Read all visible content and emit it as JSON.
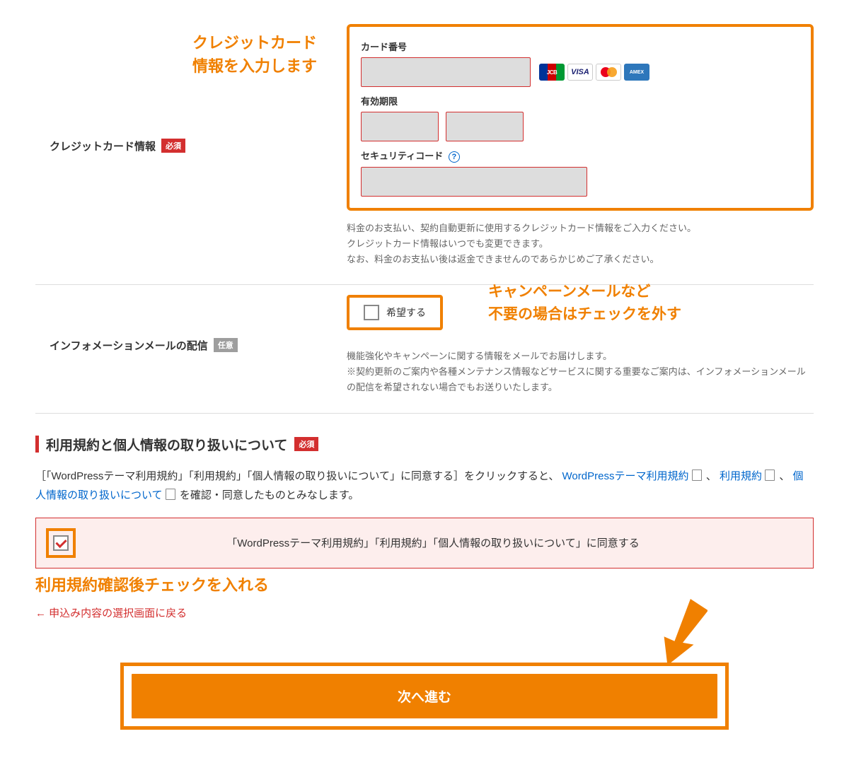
{
  "cc": {
    "label": "クレジットカード情報",
    "required_badge": "必須",
    "annot": "クレジットカード\n情報を入力します",
    "card_number_label": "カード番号",
    "expiry_label": "有効期限",
    "security_label": "セキュリティコード",
    "brands": {
      "jcb": "JCB",
      "visa": "VISA",
      "amex": "AMEX"
    },
    "hint1": "料金のお支払い、契約自動更新に使用するクレジットカード情報をご入力ください。",
    "hint2": "クレジットカード情報はいつでも変更できます。",
    "hint3": "なお、料金のお支払い後は返金できませんのであらかじめご了承ください。"
  },
  "mail": {
    "label": "インフォメーションメールの配信",
    "optional_badge": "任意",
    "checkbox_label": "希望する",
    "annot": "キャンペーンメールなど\n不要の場合はチェックを外す",
    "hint1": "機能強化やキャンペーンに関する情報をメールでお届けします。",
    "hint2": "※契約更新のご案内や各種メンテナンス情報などサービスに関する重要なご案内は、インフォメーションメールの配信を希望されない場合でもお送りいたします。"
  },
  "terms": {
    "heading": "利用規約と個人情報の取り扱いについて",
    "required_badge": "必須",
    "text_pre": "［「WordPressテーマ利用規約」「利用規約」「個人情報の取り扱いについて」に同意する］をクリックすると、",
    "link1": "WordPressテーマ利用規約",
    "sep1": "、",
    "link2": "利用規約",
    "sep2": "、",
    "link3": "個人情報の取り扱いについて",
    "text_post": " を確認・同意したものとみなします。",
    "agree_label": "「WordPressテーマ利用規約」「利用規約」「個人情報の取り扱いについて」に同意する",
    "annot": "利用規約確認後チェックを入れる"
  },
  "nav": {
    "back": "← 申込み内容の選択画面に戻る",
    "next": "次へ進む"
  }
}
